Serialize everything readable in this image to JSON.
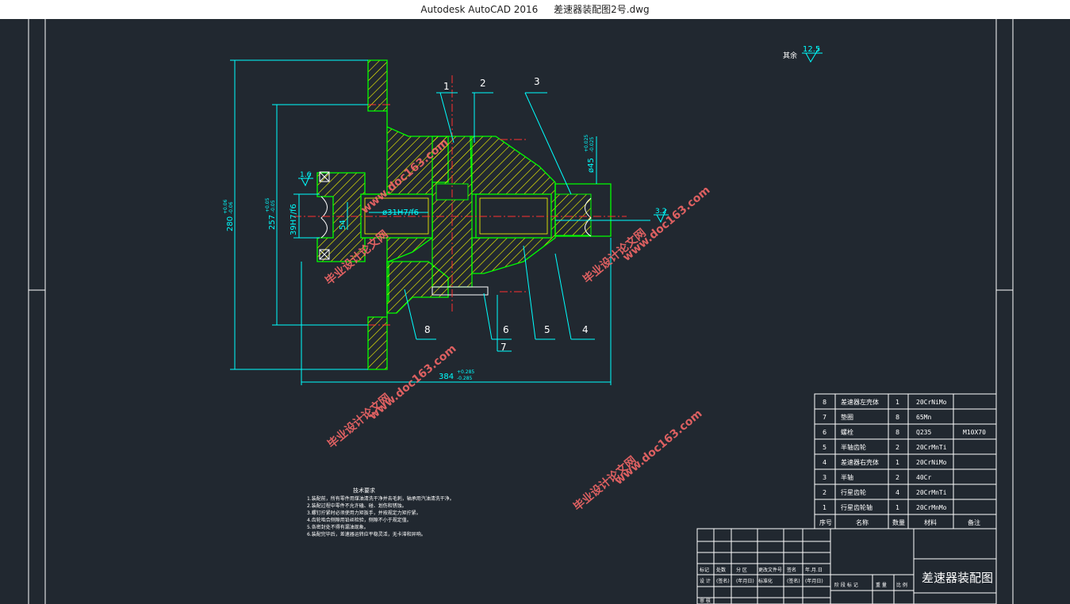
{
  "window": {
    "app_title": "Autodesk AutoCAD 2016",
    "file_name": "差速器装配图2号.dwg"
  },
  "drawing": {
    "roughness_label": "其余",
    "roughness_value": "12.5",
    "roughness_small_1": "1.6",
    "roughness_small_2": "3.2",
    "dimensions": {
      "dim_280": "280",
      "dim_280_tol_upper": "+0.06",
      "dim_280_tol_lower": "-0.06",
      "dim_257": "257",
      "dim_257_tol_upper": "+0.05",
      "dim_257_tol_lower": "-0.05",
      "dim_39": "39H7/f6",
      "dim_54": "54",
      "dim_31": "ø31H7/f6",
      "dim_45": "ø45",
      "dim_45_tol_upper": "+0.025",
      "dim_45_tol_lower": "-0.025",
      "dim_384": "384",
      "dim_384_tol_upper": "+0.285",
      "dim_384_tol_lower": "-0.285"
    },
    "balloons": [
      "1",
      "2",
      "3",
      "4",
      "5",
      "6",
      "7",
      "8"
    ],
    "watermark_text": "毕业设计论文网",
    "watermark_url": "www.doc163.com",
    "tech_notes_title": "技术要求",
    "tech_notes": [
      "1.装配前，所有零件用煤油清洗干净并去毛刺，轴承用汽油清洗干净。",
      "2.装配过程中零件不允许磕、碰、划伤和锈蚀。",
      "3.螺钉拧紧时必须使用力矩扳手，并按规定力矩拧紧。",
      "4.齿轮啮合侧隙用铅丝检验，侧隙不小于规定值。",
      "5.各密封处不得有漏油现象。",
      "6.装配完毕后，差速器运转应平稳灵活，无卡滞和异响。"
    ]
  },
  "parts_table": {
    "rows": [
      {
        "no": "8",
        "name": "差速器左壳体",
        "qty": "1",
        "material": "20CrNiMo",
        "remark": ""
      },
      {
        "no": "7",
        "name": "垫圈",
        "qty": "8",
        "material": "65Mn",
        "remark": ""
      },
      {
        "no": "6",
        "name": "螺栓",
        "qty": "8",
        "material": "Q235",
        "remark": "M10X70"
      },
      {
        "no": "5",
        "name": "半轴齿轮",
        "qty": "2",
        "material": "20CrMnTi",
        "remark": ""
      },
      {
        "no": "4",
        "name": "差速器右壳体",
        "qty": "1",
        "material": "20CrNiMo",
        "remark": ""
      },
      {
        "no": "3",
        "name": "半轴",
        "qty": "2",
        "material": "40Cr",
        "remark": ""
      },
      {
        "no": "2",
        "name": "行星齿轮",
        "qty": "4",
        "material": "20CrMnTi",
        "remark": ""
      },
      {
        "no": "1",
        "name": "行星齿轮轴",
        "qty": "1",
        "material": "20CrMnMo",
        "remark": ""
      }
    ],
    "header": {
      "no": "序号",
      "name": "名称",
      "qty": "数量",
      "material": "材料",
      "remark": "备注"
    }
  },
  "title_block": {
    "drawing_title": "差速器装配图",
    "row_labels": [
      "标记",
      "处数",
      "分 区",
      "更改文件号",
      "签名",
      "年.月.日"
    ],
    "row_labels_2": [
      "设 计",
      "(签名)",
      "(年月日)",
      "标准化",
      "(签名)",
      "(年月日)"
    ],
    "stage_labels": [
      "阶 段 标 记",
      "重 量",
      "比 例"
    ],
    "bottom_label": "审 核"
  },
  "colors": {
    "background": "#212830",
    "part_outline": "#00ff00",
    "hatch": "#ffff00",
    "dimension": "#00ffff",
    "centerline": "#ff3030",
    "text": "#ffffff",
    "watermark": "#ff6b6b"
  }
}
